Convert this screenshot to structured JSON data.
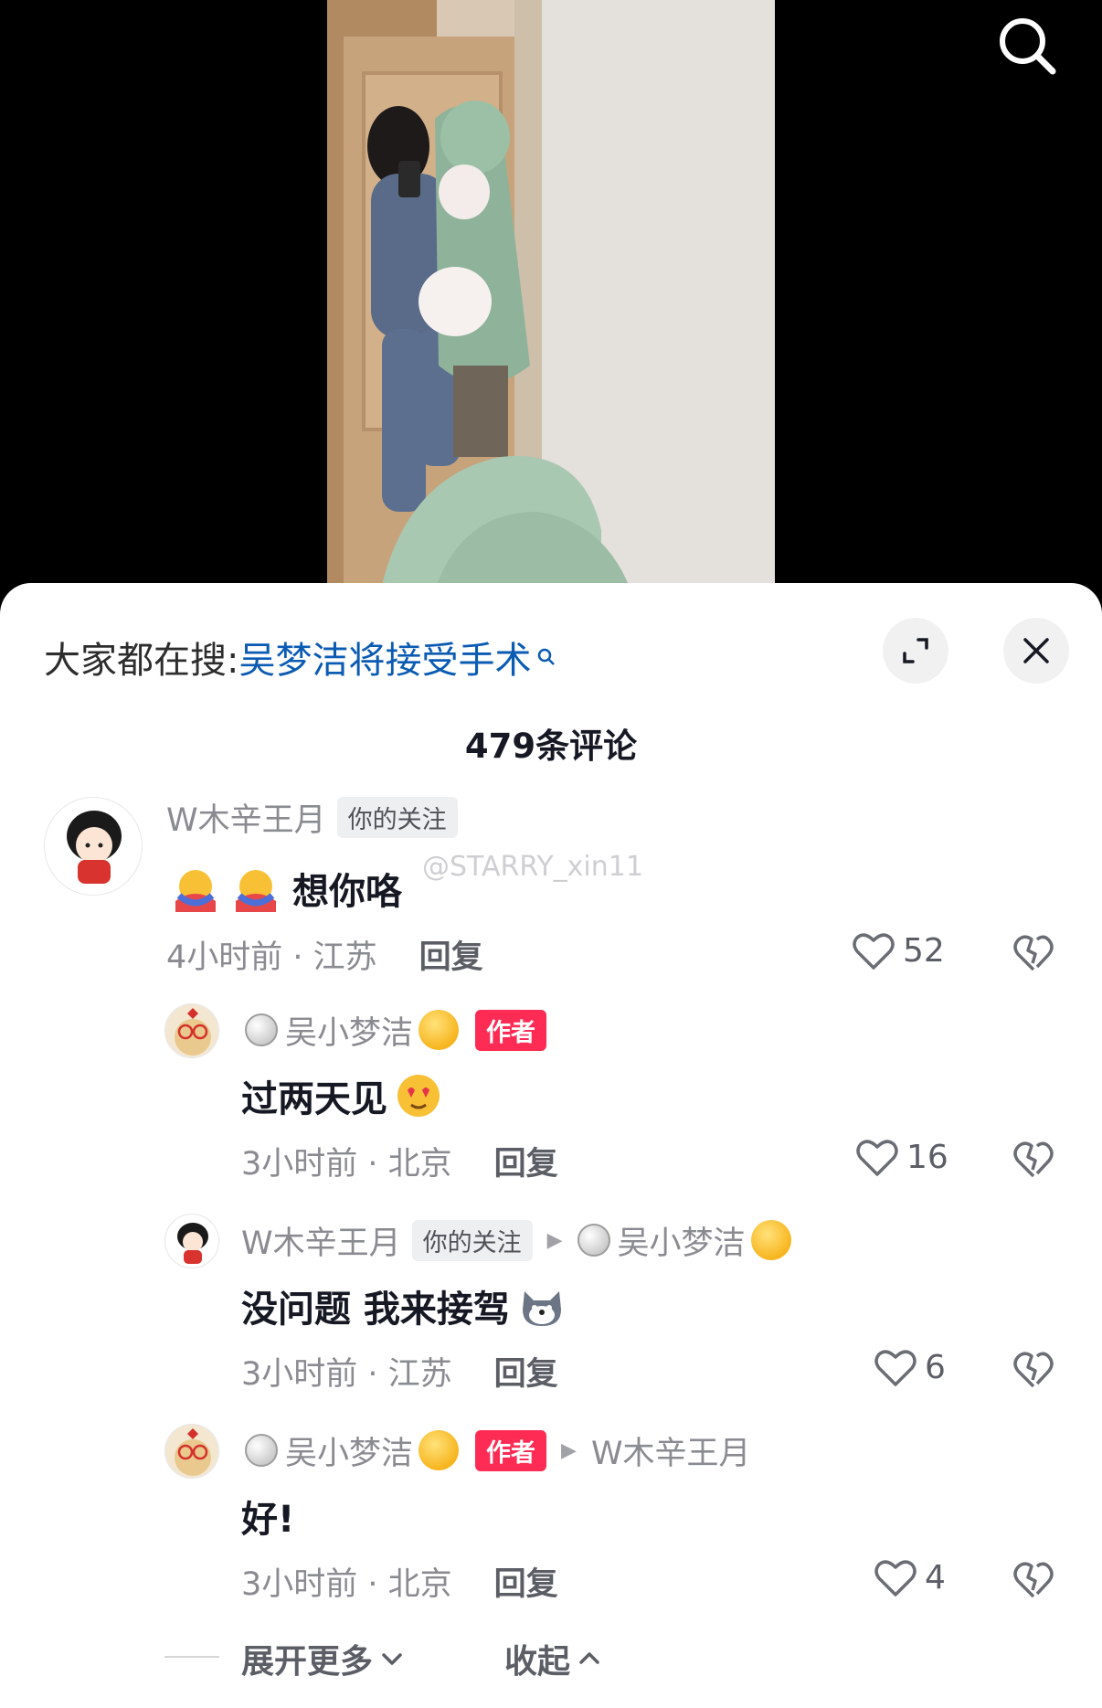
{
  "hot_search": {
    "prefix": "大家都在搜:",
    "term": "吴梦洁将接受手术"
  },
  "comment_count": "479条评论",
  "watermark": "@STARRY_xin11",
  "comments": [
    {
      "user": "W木辛王月",
      "tag": "你的关注",
      "text": "想你咯",
      "time_loc": "4小时前 · 江苏",
      "reply": "回复",
      "likes": "52"
    },
    {
      "user": "吴小梦洁",
      "tag": "作者",
      "text": "过两天见",
      "time_loc": "3小时前 · 北京",
      "reply": "回复",
      "likes": "16"
    },
    {
      "user": "W木辛王月",
      "tag": "你的关注",
      "reply_to": "吴小梦洁",
      "text": "没问题 我来接驾",
      "time_loc": "3小时前 · 江苏",
      "reply": "回复",
      "likes": "6"
    },
    {
      "user": "吴小梦洁",
      "tag": "作者",
      "reply_to": "W木辛王月",
      "text": "好!",
      "time_loc": "3小时前 · 北京",
      "reply": "回复",
      "likes": "4"
    }
  ],
  "footer": {
    "expand_more": "展开更多",
    "collapse": "收起"
  },
  "colors": {
    "author_tag": "#fe2c55",
    "hot_term": "#0b5bb3",
    "text": "#161823",
    "meta": "#8a8b91"
  },
  "icons": [
    "search-icon",
    "expand-icon",
    "close-icon",
    "heart-icon",
    "broken-heart-icon",
    "chevron-down-icon",
    "chevron-up-icon",
    "play-arrow-icon"
  ]
}
